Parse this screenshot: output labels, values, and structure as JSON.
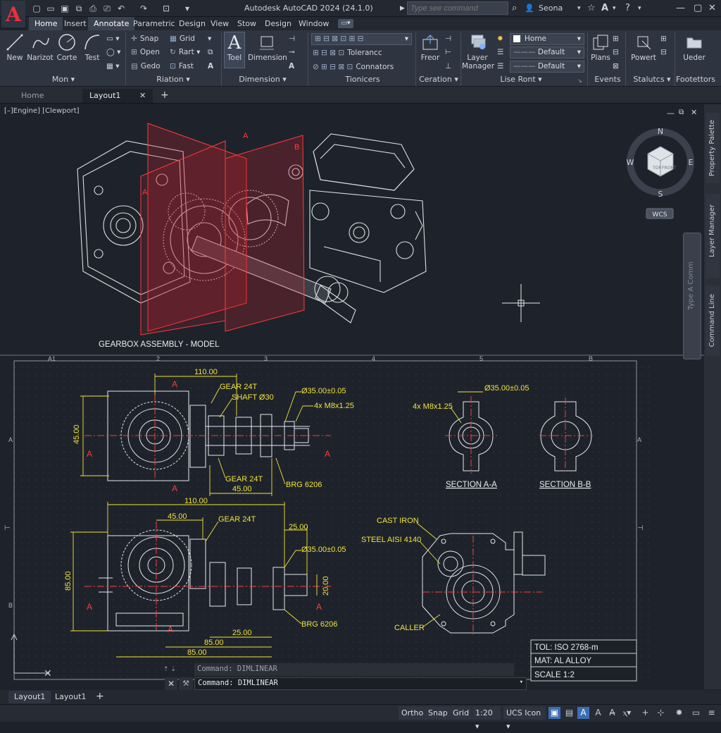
{
  "app": {
    "title": "Autodesk AutoCAD 2024  (24.1.0)",
    "logo_letter": "A"
  },
  "search": {
    "placeholder": "Type see command"
  },
  "user": {
    "name": "Seona"
  },
  "menu_tabs": [
    "Home",
    "Insert",
    "Annotate",
    "Parametric",
    "Design",
    "View",
    "Stow",
    "Design",
    "Window"
  ],
  "ribbon": {
    "mod_buttons": [
      "New",
      "Narizot",
      "Corte",
      "Test"
    ],
    "mod_title": "Mon",
    "riation_items": [
      "Snap",
      "Grid",
      "Open",
      "Rart",
      "Gedo",
      "Fast"
    ],
    "riation_title": "Riation",
    "dimension_buttons": [
      "Toel",
      "Dimension"
    ],
    "dimension_title": "Dimension",
    "tionicers_items": [
      "Tolerancc",
      "Connators"
    ],
    "tionicers_title": "Tionicers",
    "ceration_buttons": [
      "Freor"
    ],
    "ceration_title": "Ceration",
    "layer_button": "Layer Manager",
    "layer_dropdowns": [
      "Home",
      "Default",
      "Default"
    ],
    "layer_title": "Lise Ront",
    "events_button": "Plans",
    "events_title": "Events",
    "status_button": "Powert",
    "status_title": "Stalutcs",
    "foot_button": "Ueder",
    "foot_title": "Footettors"
  },
  "doc_tabs": [
    "Home",
    "Layout1"
  ],
  "viewport": {
    "label": "[–]Engine] [Clewport]"
  },
  "viewcube": {
    "n": "N",
    "s": "S",
    "e": "E",
    "w": "W",
    "top": "TOP",
    "front": "FRONT",
    "wcs": "WCS"
  },
  "palettes": [
    "Property Palette",
    "Layer Manager",
    "Command Line"
  ],
  "floating_cmd": "Type A Comm",
  "drawing": {
    "model_title": "GEARBOX ASSEMBLY - MODEL",
    "section_marks": [
      "A",
      "A",
      "B"
    ],
    "grid_cols": [
      "A1",
      "2",
      "3",
      "4",
      "5",
      "B"
    ],
    "grid_rows": [
      "A",
      "A",
      "B"
    ],
    "view1": {
      "dim_top": "110.00",
      "dim_left": "45.00",
      "dim_bottom": "45.00",
      "labels": [
        "GEAR 24T",
        "SHAFT Ø30",
        "Ø35.00±0.05",
        "4x M8x1.25",
        "GEAR 24T",
        "BRG 6206"
      ]
    },
    "view2": {
      "dim_top": "110.00",
      "dim_inner": "45.00",
      "dim_left": "85.00",
      "dim_right": "25.00",
      "dim_small": "20.00",
      "dim_bot1": "25.00",
      "dim_bot2": "85.00",
      "dim_bot3": "85.00",
      "labels": [
        "GEAR 24T",
        "Ø35.00±0.05",
        "BRG 6206"
      ]
    },
    "sectionA": {
      "title": "SECTION A-A",
      "dia": "Ø35.00±0.05",
      "thread": "4x M8x1.25"
    },
    "sectionB": {
      "title": "SECTION B-B"
    },
    "housing": {
      "labels": [
        "CAST IRON",
        "STEEL AISI 4140",
        "CALLER"
      ]
    },
    "title_block": [
      "TOL: ISO 2768-m",
      "MAT: AL ALLOY",
      "SCALE 1:2"
    ]
  },
  "command": {
    "history": "Command: DIMLINEAR",
    "input": "Command: DIMLINEAR",
    "history_marker": "⇡ ⇣"
  },
  "layout_tabs": [
    "Layout1",
    "Layout1"
  ],
  "statusbar": {
    "items": [
      "Ortho",
      "Snap",
      "Grid",
      "1:20",
      "UCS Icon"
    ]
  },
  "colors": {
    "accent": "#3d6db5",
    "dimension": "#f2e33a",
    "section": "#ff3b3b",
    "logo": "#e8313a"
  }
}
